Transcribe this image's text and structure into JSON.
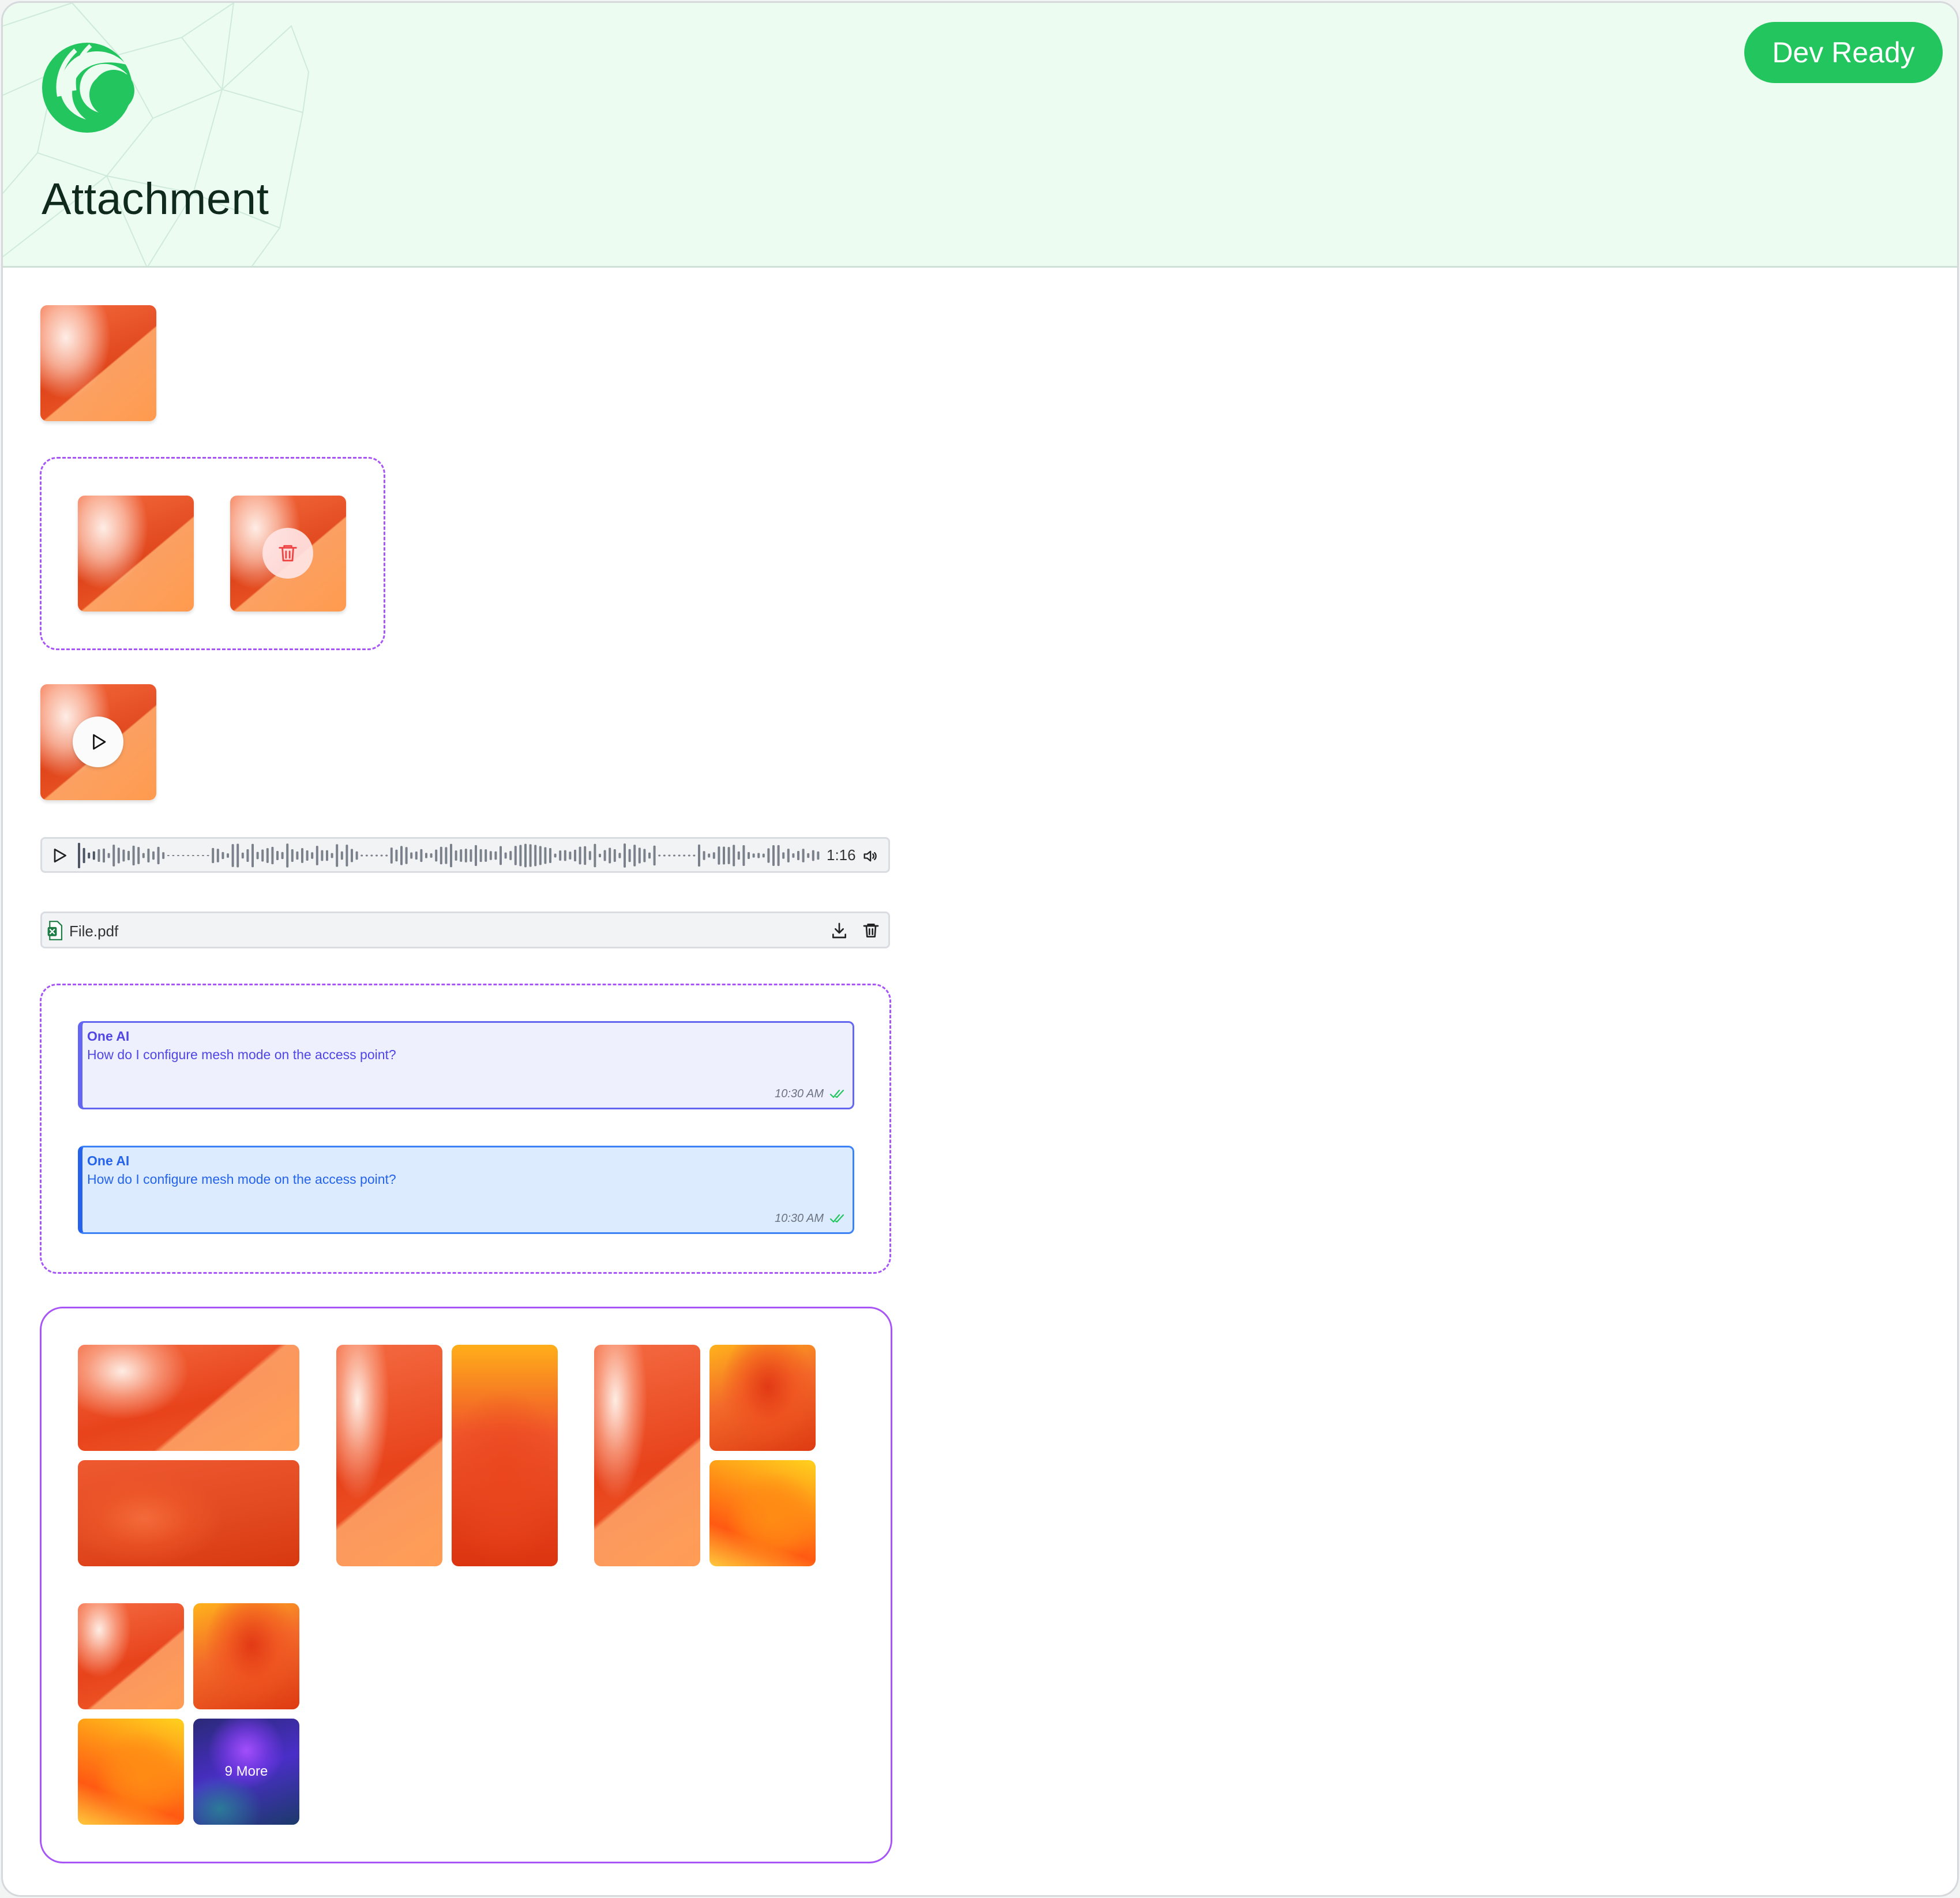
{
  "header": {
    "title": "Attachment",
    "status_badge": "Dev Ready",
    "logo": "brand-logo",
    "colors": {
      "header_bg": "#edfcf1",
      "badge_bg": "#22c55e",
      "group_border": "#a855f7"
    }
  },
  "video": {
    "play_icon": "play-icon"
  },
  "multi_select": {
    "delete_icon": "trash-icon"
  },
  "audio": {
    "duration": "1:16",
    "play_icon": "play-icon",
    "volume_icon": "volume-icon"
  },
  "file": {
    "name": "File.pdf",
    "file_icon": "spreadsheet-file-icon",
    "download_icon": "download-icon",
    "delete_icon": "trash-icon"
  },
  "messages": [
    {
      "sender": "One AI",
      "text": "How do I configure mesh mode on the access point?",
      "time": "10:30 AM",
      "status_icon": "double-check-icon",
      "accent": "#6366f1"
    },
    {
      "sender": "One AI",
      "text": "How do I configure mesh mode on the access point?",
      "time": "10:30 AM",
      "status_icon": "double-check-icon",
      "accent": "#2563eb"
    }
  ],
  "gallery": {
    "more_label": "9 More"
  }
}
